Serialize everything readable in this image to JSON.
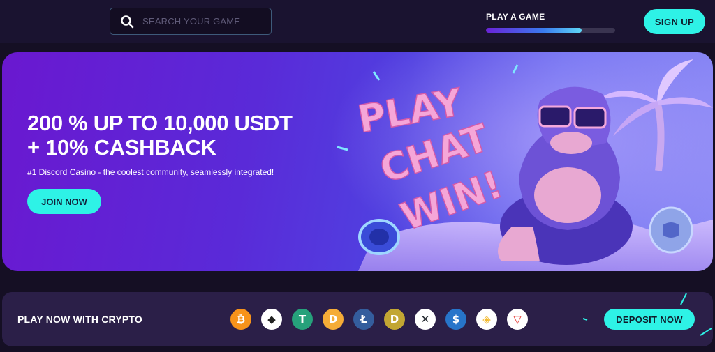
{
  "header": {
    "search": {
      "placeholder": "SEARCH YOUR GAME",
      "value": ""
    },
    "progress": {
      "label": "PLAY A GAME",
      "fraction": 0.74
    },
    "signup_label": "SIGN UP"
  },
  "banner": {
    "title_line1": "200 % UP TO 10,000 USDT",
    "title_line2": "+ 10% CASHBACK",
    "subtitle": "#1 Discord Casino - the coolest community, seamlessly integrated!",
    "join_label": "JOIN NOW",
    "art_words": [
      "PLAY",
      "CHAT",
      "WIN!"
    ]
  },
  "crypto": {
    "label": "PLAY NOW WITH CRYPTO",
    "coins": [
      {
        "name": "bitcoin-icon",
        "color": "#f7931a",
        "glyph": "₿"
      },
      {
        "name": "ethereum-icon",
        "color": "#ffffff",
        "glyph": "◆"
      },
      {
        "name": "tether-icon",
        "color": "#26a17b",
        "glyph": "T"
      },
      {
        "name": "dai-icon",
        "color": "#f5ac37",
        "glyph": "D"
      },
      {
        "name": "litecoin-icon",
        "color": "#345d9d",
        "glyph": "Ł"
      },
      {
        "name": "dogecoin-icon",
        "color": "#c2a633",
        "glyph": "D"
      },
      {
        "name": "xrp-icon",
        "color": "#ffffff",
        "glyph": "✕"
      },
      {
        "name": "usdc-icon",
        "color": "#2775ca",
        "glyph": "$"
      },
      {
        "name": "binance-coin-icon",
        "color": "#ffffff",
        "glyph": "◈"
      },
      {
        "name": "tron-icon",
        "color": "#ffffff",
        "glyph": "▽"
      }
    ],
    "deposit_label": "DEPOSIT NOW"
  },
  "colors": {
    "accent": "#2ef2e6",
    "background": "#150f24",
    "bar": "#2b1f48"
  }
}
